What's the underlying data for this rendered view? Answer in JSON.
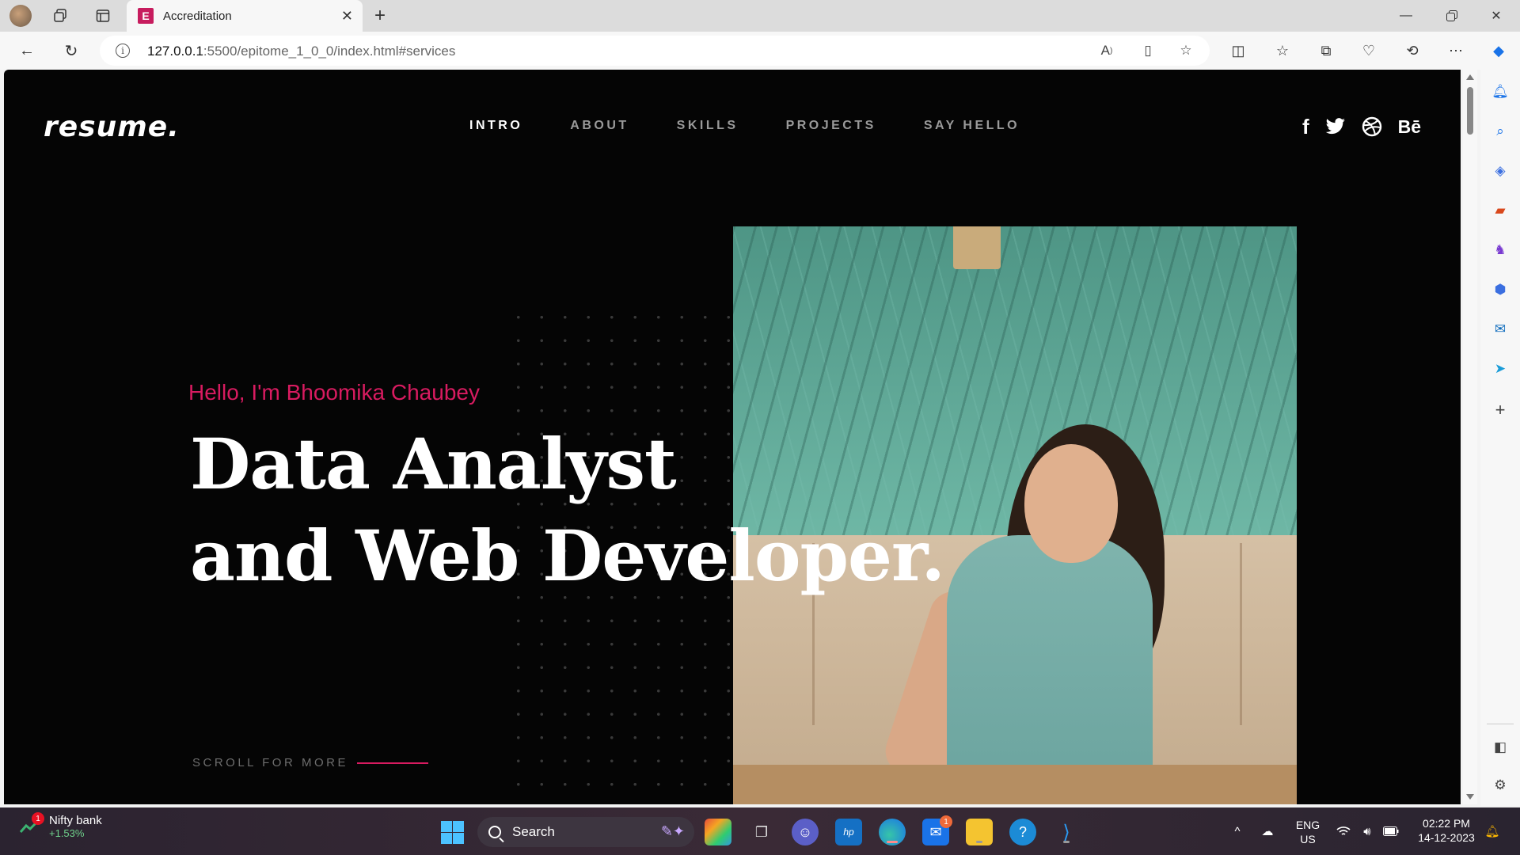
{
  "browser": {
    "tab": {
      "favicon_letter": "E",
      "title": "Accreditation"
    },
    "address": {
      "host": "127.0.0.1",
      "path": ":5500/epitome_1_0_0/index.html#services"
    }
  },
  "site": {
    "logo": "resume.",
    "nav": [
      {
        "label": "INTRO",
        "active": true
      },
      {
        "label": "ABOUT",
        "active": false
      },
      {
        "label": "SKILLS",
        "active": false
      },
      {
        "label": "PROJECTS",
        "active": false
      },
      {
        "label": "SAY HELLO",
        "active": false
      }
    ],
    "social": {
      "facebook": "f",
      "behance": "Bē"
    },
    "hero": {
      "greeting": "Hello, I'm Bhoomika Chaubey",
      "headline_line1": "Data Analyst",
      "headline_line2": "and Web Developer.",
      "scroll_label": "SCROLL FOR MORE"
    },
    "colors": {
      "accent": "#d81b60",
      "background": "#050505"
    }
  },
  "taskbar": {
    "widget": {
      "title": "Nifty bank",
      "change": "+1.53%",
      "badge": "1"
    },
    "search_label": "Search",
    "mail_badge": "1",
    "language": {
      "line1": "ENG",
      "line2": "US"
    },
    "clock": {
      "time": "02:22 PM",
      "date": "14-12-2023"
    }
  }
}
